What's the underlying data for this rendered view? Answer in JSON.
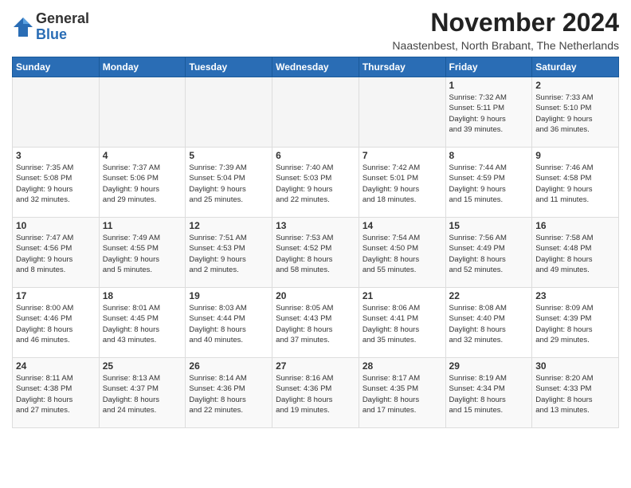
{
  "header": {
    "logo_general": "General",
    "logo_blue": "Blue",
    "month_title": "November 2024",
    "location": "Naastenbest, North Brabant, The Netherlands"
  },
  "weekdays": [
    "Sunday",
    "Monday",
    "Tuesday",
    "Wednesday",
    "Thursday",
    "Friday",
    "Saturday"
  ],
  "weeks": [
    [
      {
        "day": "",
        "info": ""
      },
      {
        "day": "",
        "info": ""
      },
      {
        "day": "",
        "info": ""
      },
      {
        "day": "",
        "info": ""
      },
      {
        "day": "",
        "info": ""
      },
      {
        "day": "1",
        "info": "Sunrise: 7:32 AM\nSunset: 5:11 PM\nDaylight: 9 hours\nand 39 minutes."
      },
      {
        "day": "2",
        "info": "Sunrise: 7:33 AM\nSunset: 5:10 PM\nDaylight: 9 hours\nand 36 minutes."
      }
    ],
    [
      {
        "day": "3",
        "info": "Sunrise: 7:35 AM\nSunset: 5:08 PM\nDaylight: 9 hours\nand 32 minutes."
      },
      {
        "day": "4",
        "info": "Sunrise: 7:37 AM\nSunset: 5:06 PM\nDaylight: 9 hours\nand 29 minutes."
      },
      {
        "day": "5",
        "info": "Sunrise: 7:39 AM\nSunset: 5:04 PM\nDaylight: 9 hours\nand 25 minutes."
      },
      {
        "day": "6",
        "info": "Sunrise: 7:40 AM\nSunset: 5:03 PM\nDaylight: 9 hours\nand 22 minutes."
      },
      {
        "day": "7",
        "info": "Sunrise: 7:42 AM\nSunset: 5:01 PM\nDaylight: 9 hours\nand 18 minutes."
      },
      {
        "day": "8",
        "info": "Sunrise: 7:44 AM\nSunset: 4:59 PM\nDaylight: 9 hours\nand 15 minutes."
      },
      {
        "day": "9",
        "info": "Sunrise: 7:46 AM\nSunset: 4:58 PM\nDaylight: 9 hours\nand 11 minutes."
      }
    ],
    [
      {
        "day": "10",
        "info": "Sunrise: 7:47 AM\nSunset: 4:56 PM\nDaylight: 9 hours\nand 8 minutes."
      },
      {
        "day": "11",
        "info": "Sunrise: 7:49 AM\nSunset: 4:55 PM\nDaylight: 9 hours\nand 5 minutes."
      },
      {
        "day": "12",
        "info": "Sunrise: 7:51 AM\nSunset: 4:53 PM\nDaylight: 9 hours\nand 2 minutes."
      },
      {
        "day": "13",
        "info": "Sunrise: 7:53 AM\nSunset: 4:52 PM\nDaylight: 8 hours\nand 58 minutes."
      },
      {
        "day": "14",
        "info": "Sunrise: 7:54 AM\nSunset: 4:50 PM\nDaylight: 8 hours\nand 55 minutes."
      },
      {
        "day": "15",
        "info": "Sunrise: 7:56 AM\nSunset: 4:49 PM\nDaylight: 8 hours\nand 52 minutes."
      },
      {
        "day": "16",
        "info": "Sunrise: 7:58 AM\nSunset: 4:48 PM\nDaylight: 8 hours\nand 49 minutes."
      }
    ],
    [
      {
        "day": "17",
        "info": "Sunrise: 8:00 AM\nSunset: 4:46 PM\nDaylight: 8 hours\nand 46 minutes."
      },
      {
        "day": "18",
        "info": "Sunrise: 8:01 AM\nSunset: 4:45 PM\nDaylight: 8 hours\nand 43 minutes."
      },
      {
        "day": "19",
        "info": "Sunrise: 8:03 AM\nSunset: 4:44 PM\nDaylight: 8 hours\nand 40 minutes."
      },
      {
        "day": "20",
        "info": "Sunrise: 8:05 AM\nSunset: 4:43 PM\nDaylight: 8 hours\nand 37 minutes."
      },
      {
        "day": "21",
        "info": "Sunrise: 8:06 AM\nSunset: 4:41 PM\nDaylight: 8 hours\nand 35 minutes."
      },
      {
        "day": "22",
        "info": "Sunrise: 8:08 AM\nSunset: 4:40 PM\nDaylight: 8 hours\nand 32 minutes."
      },
      {
        "day": "23",
        "info": "Sunrise: 8:09 AM\nSunset: 4:39 PM\nDaylight: 8 hours\nand 29 minutes."
      }
    ],
    [
      {
        "day": "24",
        "info": "Sunrise: 8:11 AM\nSunset: 4:38 PM\nDaylight: 8 hours\nand 27 minutes."
      },
      {
        "day": "25",
        "info": "Sunrise: 8:13 AM\nSunset: 4:37 PM\nDaylight: 8 hours\nand 24 minutes."
      },
      {
        "day": "26",
        "info": "Sunrise: 8:14 AM\nSunset: 4:36 PM\nDaylight: 8 hours\nand 22 minutes."
      },
      {
        "day": "27",
        "info": "Sunrise: 8:16 AM\nSunset: 4:36 PM\nDaylight: 8 hours\nand 19 minutes."
      },
      {
        "day": "28",
        "info": "Sunrise: 8:17 AM\nSunset: 4:35 PM\nDaylight: 8 hours\nand 17 minutes."
      },
      {
        "day": "29",
        "info": "Sunrise: 8:19 AM\nSunset: 4:34 PM\nDaylight: 8 hours\nand 15 minutes."
      },
      {
        "day": "30",
        "info": "Sunrise: 8:20 AM\nSunset: 4:33 PM\nDaylight: 8 hours\nand 13 minutes."
      }
    ]
  ]
}
